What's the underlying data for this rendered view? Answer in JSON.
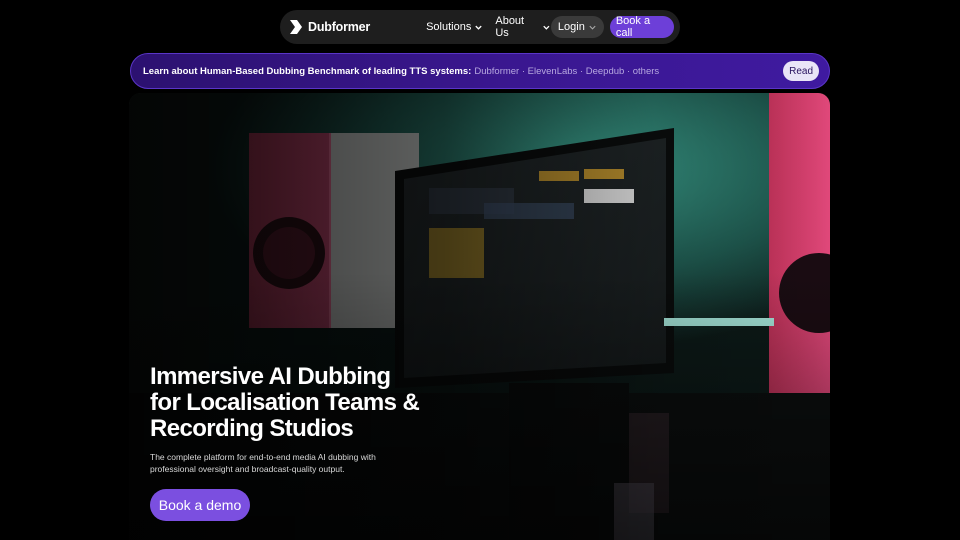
{
  "nav": {
    "logo_text": "Dubformer",
    "links": [
      {
        "label": "Solutions"
      },
      {
        "label": "About Us"
      }
    ],
    "login_label": "Login",
    "cta_label": "Book a call"
  },
  "banner": {
    "strong_text": "Learn about Human-Based Dubbing Benchmark of leading TTS systems:",
    "light_text": "Dubformer · ElevenLabs · Deepdub · others",
    "read_label": "Read"
  },
  "hero": {
    "title_line1": "Immersive AI Dubbing",
    "title_line2": "for Localisation Teams &",
    "title_line3": "Recording Studios",
    "subtitle_line1": "The complete platform for end-to-end media AI dubbing with",
    "subtitle_line2": "professional oversight and broadcast-quality output.",
    "cta_label": "Book a demo"
  },
  "colors": {
    "accent": "#7b4fe0",
    "banner": "#3a1790",
    "nav_bg": "#1e1e1e"
  },
  "icons": [
    "dubformer-logo-icon",
    "chevron-down-icon"
  ]
}
